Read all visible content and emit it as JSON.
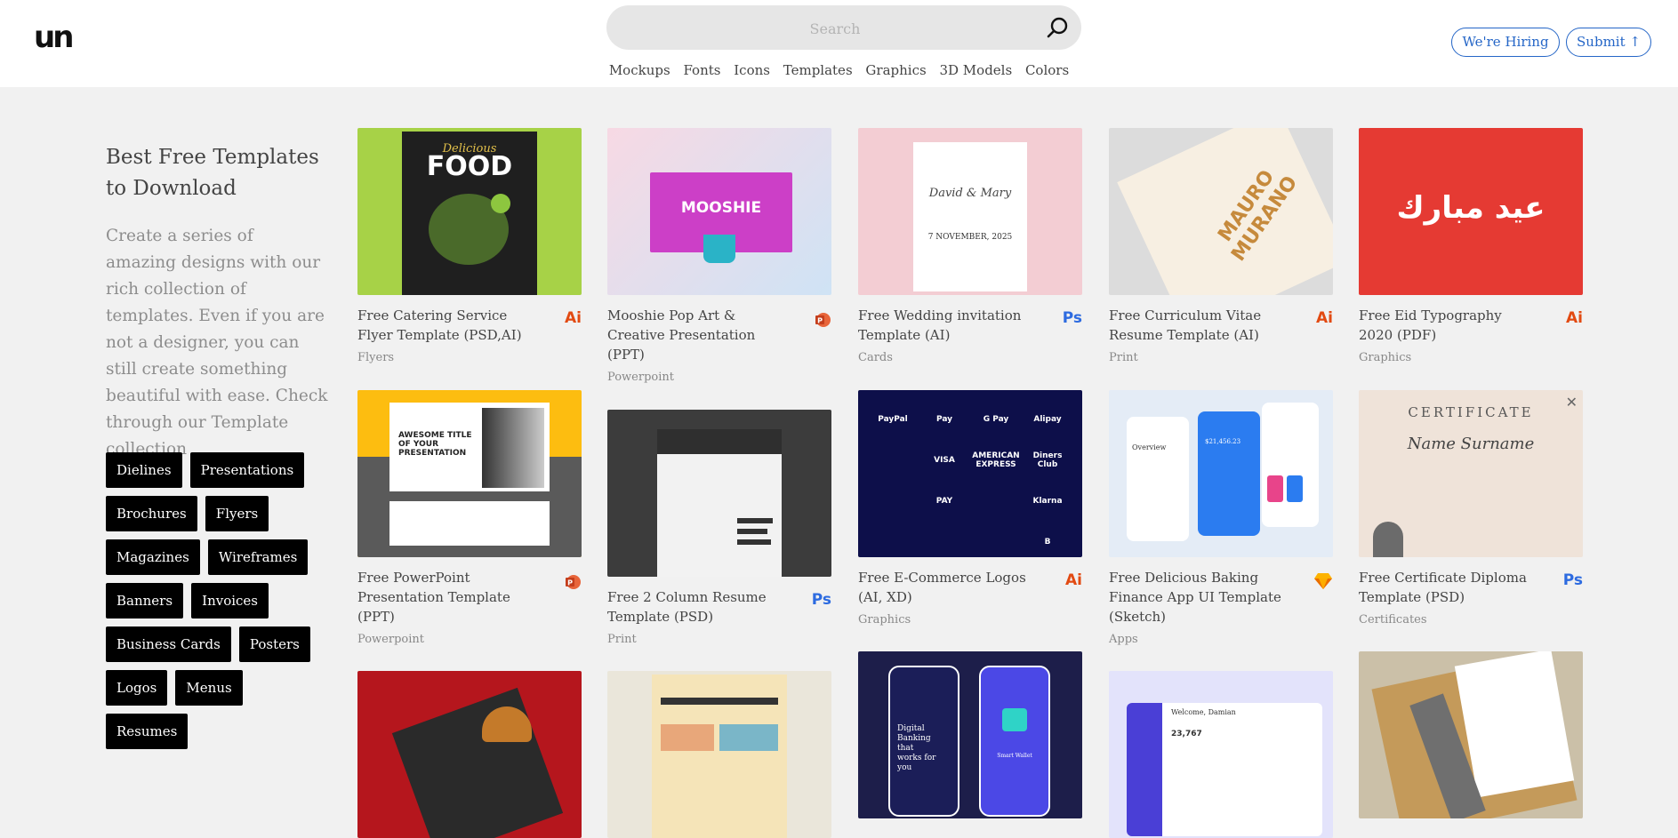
{
  "header": {
    "logo": "un",
    "search_placeholder": "Search",
    "nav": [
      "Mockups",
      "Fonts",
      "Icons",
      "Templates",
      "Graphics",
      "3D Models",
      "Colors"
    ],
    "hiring_label": "We're Hiring",
    "submit_label": "Submit ↑"
  },
  "sidebar": {
    "title": "Best Free Templates to Download",
    "description": "Create a series of amazing designs with our rich collection of templates. Even if you are not a designer, you can still create something beautiful with ease. Check through our Template collection",
    "tags": [
      "Dielines",
      "Presentations",
      "Brochures",
      "Flyers",
      "Magazines",
      "Wireframes",
      "Banners",
      "Invoices",
      "Business Cards",
      "Posters",
      "Logos",
      "Menus",
      "Resumes"
    ]
  },
  "cards": [
    {
      "title": "Free Catering Service Flyer Template (PSD,AI)",
      "category": "Flyers",
      "badge": "Ai",
      "thumb_text": "FOOD",
      "thumb_subtext": "Delicious"
    },
    {
      "title": "Mooshie Pop Art & Creative Presentation (PPT)",
      "category": "Powerpoint",
      "badge": "ppt-icon",
      "thumb_text": "MOOSHIE"
    },
    {
      "title": "Free Wedding invitation Template (AI)",
      "category": "Cards",
      "badge": "Ps",
      "thumb_text": "David & Mary",
      "thumb_subtext": "7 NOVEMBER, 2025"
    },
    {
      "title": "Free Curriculum Vitae Resume Template (AI)",
      "category": "Print",
      "badge": "Ai",
      "thumb_text": "MAURO MURANO"
    },
    {
      "title": "Free Eid Typography 2020 (PDF)",
      "category": "Graphics",
      "badge": "Ai",
      "thumb_text": "عيد مبارك"
    },
    {
      "title": "Free PowerPoint Presentation Template (PPT)",
      "category": "Powerpoint",
      "badge": "ppt-icon",
      "thumb_text": "AWESOME TITLE OF YOUR PRESENTATION"
    },
    {
      "title": "Free 2 Column Resume Template (PSD)",
      "category": "Print",
      "badge": "Ps"
    },
    {
      "title": "Free E-Commerce Logos (AI, XD)",
      "category": "Graphics",
      "badge": "Ai",
      "thumb_logos": [
        "PayPal",
        "Pay",
        "G Pay",
        "Alipay",
        "",
        "VISA",
        "AMERICAN EXPRESS",
        "Diners Club",
        "",
        "PAY",
        "",
        "Klarna",
        "",
        "",
        "",
        "B"
      ]
    },
    {
      "title": "Free Delicious Baking Finance App UI Template (Sketch)",
      "category": "Apps",
      "badge": "sketch-icon",
      "thumb_text": "Overview",
      "thumb_subtext": "$21,456.23"
    },
    {
      "title": "Free Certificate Diploma Template (PSD)",
      "category": "Certificates",
      "badge": "Ps",
      "thumb_text": "CERTIFICATE",
      "thumb_subtext": "Name Surname"
    },
    {
      "title": "",
      "category": "",
      "badge": ""
    },
    {
      "title": "",
      "category": "",
      "badge": ""
    },
    {
      "title": "",
      "category": "",
      "badge": "",
      "thumb_text": "Digital Banking that works for you",
      "thumb_subtext": "Smart Wallet"
    },
    {
      "title": "",
      "category": "",
      "badge": "",
      "thumb_text": "Welcome, Damian",
      "thumb_subtext": "23,767"
    },
    {
      "title": "",
      "category": "",
      "badge": ""
    }
  ],
  "colors": {
    "accent": "#2566c7",
    "ai_badge": "#e24a12",
    "ps_badge": "#2d6be0"
  }
}
